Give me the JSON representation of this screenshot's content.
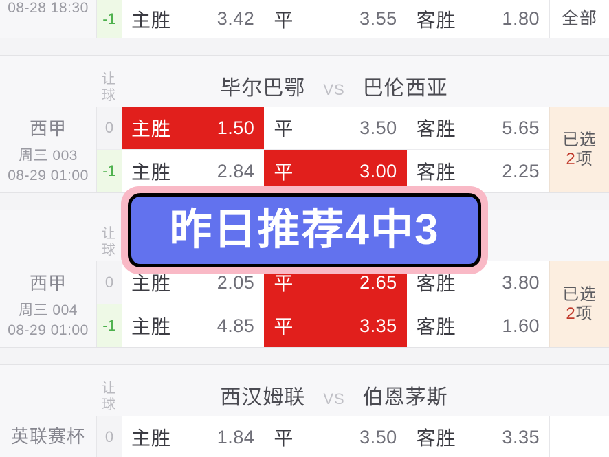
{
  "promo": {
    "text": "昨日推荐4中3",
    "fill_color": "#6272ee",
    "outline_color": "#f9b9c6",
    "border_color": "#000000",
    "text_color": "#ffffff"
  },
  "labels": {
    "handicap_header_line1": "让",
    "handicap_header_line2": "球",
    "vs": "VS",
    "home_win": "主胜",
    "draw": "平",
    "away_win": "客胜",
    "selected_prefix": "已选",
    "selected_suffix": "项",
    "all": "全部"
  },
  "colors": {
    "selected_cell": "#e11f1c",
    "selected_text": "#ffffff",
    "handicap_negative": "#4cb04c",
    "selected_badge_bg": "#fceee0",
    "count_accent": "#c0392b"
  },
  "matches": [
    {
      "id": "partial-top",
      "league": "",
      "round": "",
      "time": "08-28 18:30",
      "home_team": "",
      "away_team": "",
      "status_label": "全部",
      "status_type": "plain",
      "rows": [
        {
          "handicap": "-1",
          "handicap_type": "neg",
          "home_label": "主胜",
          "home_odds": "",
          "home_selected": false,
          "draw_label": "平",
          "draw_odds": "3.42",
          "draw_selected": false,
          "away_label": "客胜",
          "away_odds": "3.55",
          "away_selected": false,
          "last_odds": "1.80"
        }
      ]
    },
    {
      "id": "match-003",
      "league": "西甲",
      "round": "周三 003",
      "time": "08-29 01:00",
      "home_team": "毕尔巴鄂",
      "away_team": "巴伦西亚",
      "status_label": "已选",
      "status_count": "2",
      "status_type": "selected",
      "rows": [
        {
          "handicap": "0",
          "handicap_type": "zero",
          "home_label": "主胜",
          "home_odds": "1.50",
          "home_selected": true,
          "draw_label": "平",
          "draw_odds": "3.50",
          "draw_selected": false,
          "away_label": "客胜",
          "away_odds": "5.65",
          "away_selected": false
        },
        {
          "handicap": "-1",
          "handicap_type": "neg",
          "home_label": "主胜",
          "home_odds": "2.84",
          "home_selected": false,
          "draw_label": "平",
          "draw_odds": "3.00",
          "draw_selected": true,
          "away_label": "客胜",
          "away_odds": "2.25",
          "away_selected": false
        }
      ]
    },
    {
      "id": "match-004",
      "league": "西甲",
      "round": "周三 004",
      "time": "08-29 01:00",
      "home_team": "",
      "away_team": "",
      "status_label": "已选",
      "status_count": "2",
      "status_type": "selected",
      "rows": [
        {
          "handicap": "0",
          "handicap_type": "zero",
          "home_label": "主胜",
          "home_odds": "2.05",
          "home_selected": false,
          "draw_label": "平",
          "draw_odds": "2.65",
          "draw_selected": true,
          "away_label": "客胜",
          "away_odds": "3.80",
          "away_selected": false
        },
        {
          "handicap": "-1",
          "handicap_type": "neg",
          "home_label": "主胜",
          "home_odds": "4.85",
          "home_selected": false,
          "draw_label": "平",
          "draw_odds": "3.35",
          "draw_selected": true,
          "away_label": "客胜",
          "away_odds": "1.60",
          "away_selected": false
        }
      ]
    },
    {
      "id": "match-efl",
      "league": "英联赛杯",
      "round": "",
      "time": "",
      "home_team": "西汉姆联",
      "away_team": "伯恩茅斯",
      "status_label": "",
      "status_type": "plain",
      "rows": [
        {
          "handicap": "0",
          "handicap_type": "zero",
          "home_label": "主胜",
          "home_odds": "1.84",
          "home_selected": false,
          "draw_label": "平",
          "draw_odds": "3.50",
          "draw_selected": false,
          "away_label": "客胜",
          "away_odds": "3.35",
          "away_selected": false
        }
      ]
    }
  ]
}
